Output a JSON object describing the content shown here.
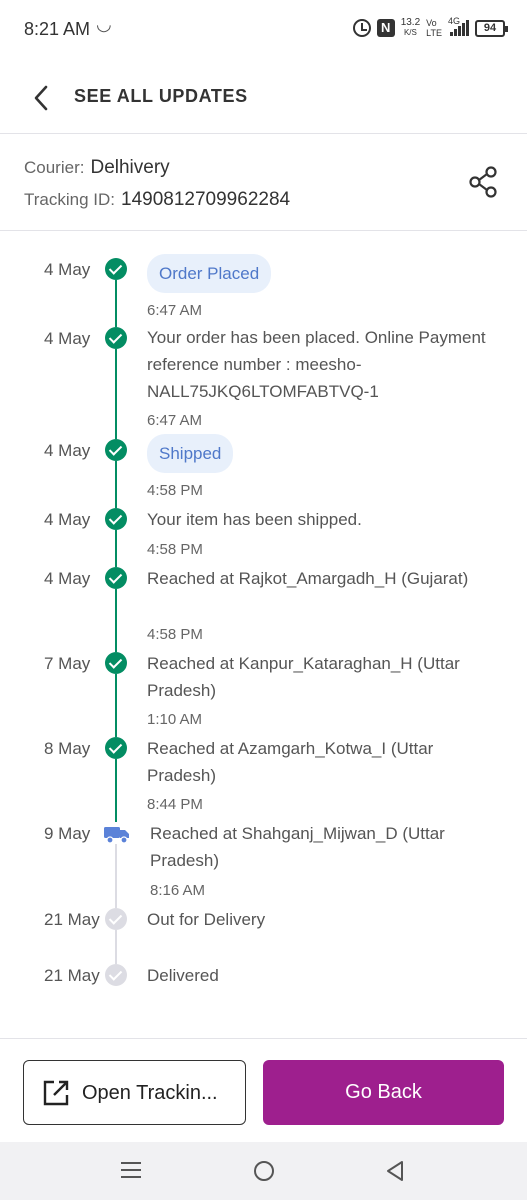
{
  "status_bar": {
    "time": "8:21 AM",
    "speed_value": "13.2",
    "speed_unit": "K/S",
    "volte_top": "Vo",
    "volte_bottom": "LTE",
    "network": "4G",
    "battery": "94"
  },
  "header": {
    "title": "SEE ALL UPDATES"
  },
  "courier": {
    "courier_label": "Courier:",
    "courier_value": "Delhivery",
    "tracking_label": "Tracking ID:",
    "tracking_value": "1490812709962284"
  },
  "timeline": [
    {
      "date": "4 May",
      "text": "Order Placed",
      "pill": true,
      "time": "6:47 AM",
      "status": "done"
    },
    {
      "date": "4 May",
      "text": "Your order has been placed. Online Payment reference number : meesho-NALL75JKQ6LTOMFABTVQ-1",
      "pill": false,
      "time": "6:47 AM",
      "status": "done"
    },
    {
      "date": "4 May",
      "text": "Shipped",
      "pill": true,
      "time": "4:58 PM",
      "status": "done"
    },
    {
      "date": "4 May",
      "text": "Your item has been shipped.",
      "pill": false,
      "time": "4:58 PM",
      "status": "done"
    },
    {
      "date": "4 May",
      "text": "Reached at Rajkot_Amargadh_H (Gujarat)",
      "pill": false,
      "time": "4:58 PM",
      "status": "done"
    },
    {
      "date": "7 May",
      "text": "Reached at Kanpur_Kataraghan_H (Uttar Pradesh)",
      "pill": false,
      "time": "1:10 AM",
      "status": "done"
    },
    {
      "date": "8 May",
      "text": "Reached at Azamgarh_Kotwa_I (Uttar Pradesh)",
      "pill": false,
      "time": "8:44 PM",
      "status": "done"
    },
    {
      "date": "9 May",
      "text": "Reached at Shahganj_Mijwan_D (Uttar Pradesh)",
      "pill": false,
      "time": "8:16 AM",
      "status": "current"
    },
    {
      "date": "21 May",
      "text": "Out for Delivery",
      "pill": false,
      "time": "",
      "status": "pending"
    },
    {
      "date": "21 May",
      "text": "Delivered",
      "pill": false,
      "time": "",
      "status": "pending"
    }
  ],
  "bottom": {
    "open_tracking_label": "Open Trackin...",
    "go_back_label": "Go Back"
  },
  "colors": {
    "done": "#038d63",
    "pending": "#dcdce3",
    "accent": "#9e1f8e",
    "pill_bg": "#e8f0fb",
    "pill_text": "#4f78c9",
    "truck": "#5b82d8"
  },
  "icons": {
    "back": "chevron-left-icon",
    "share": "share-icon",
    "open_external": "external-link-icon",
    "truck": "truck-icon",
    "check": "check-circle-icon"
  }
}
